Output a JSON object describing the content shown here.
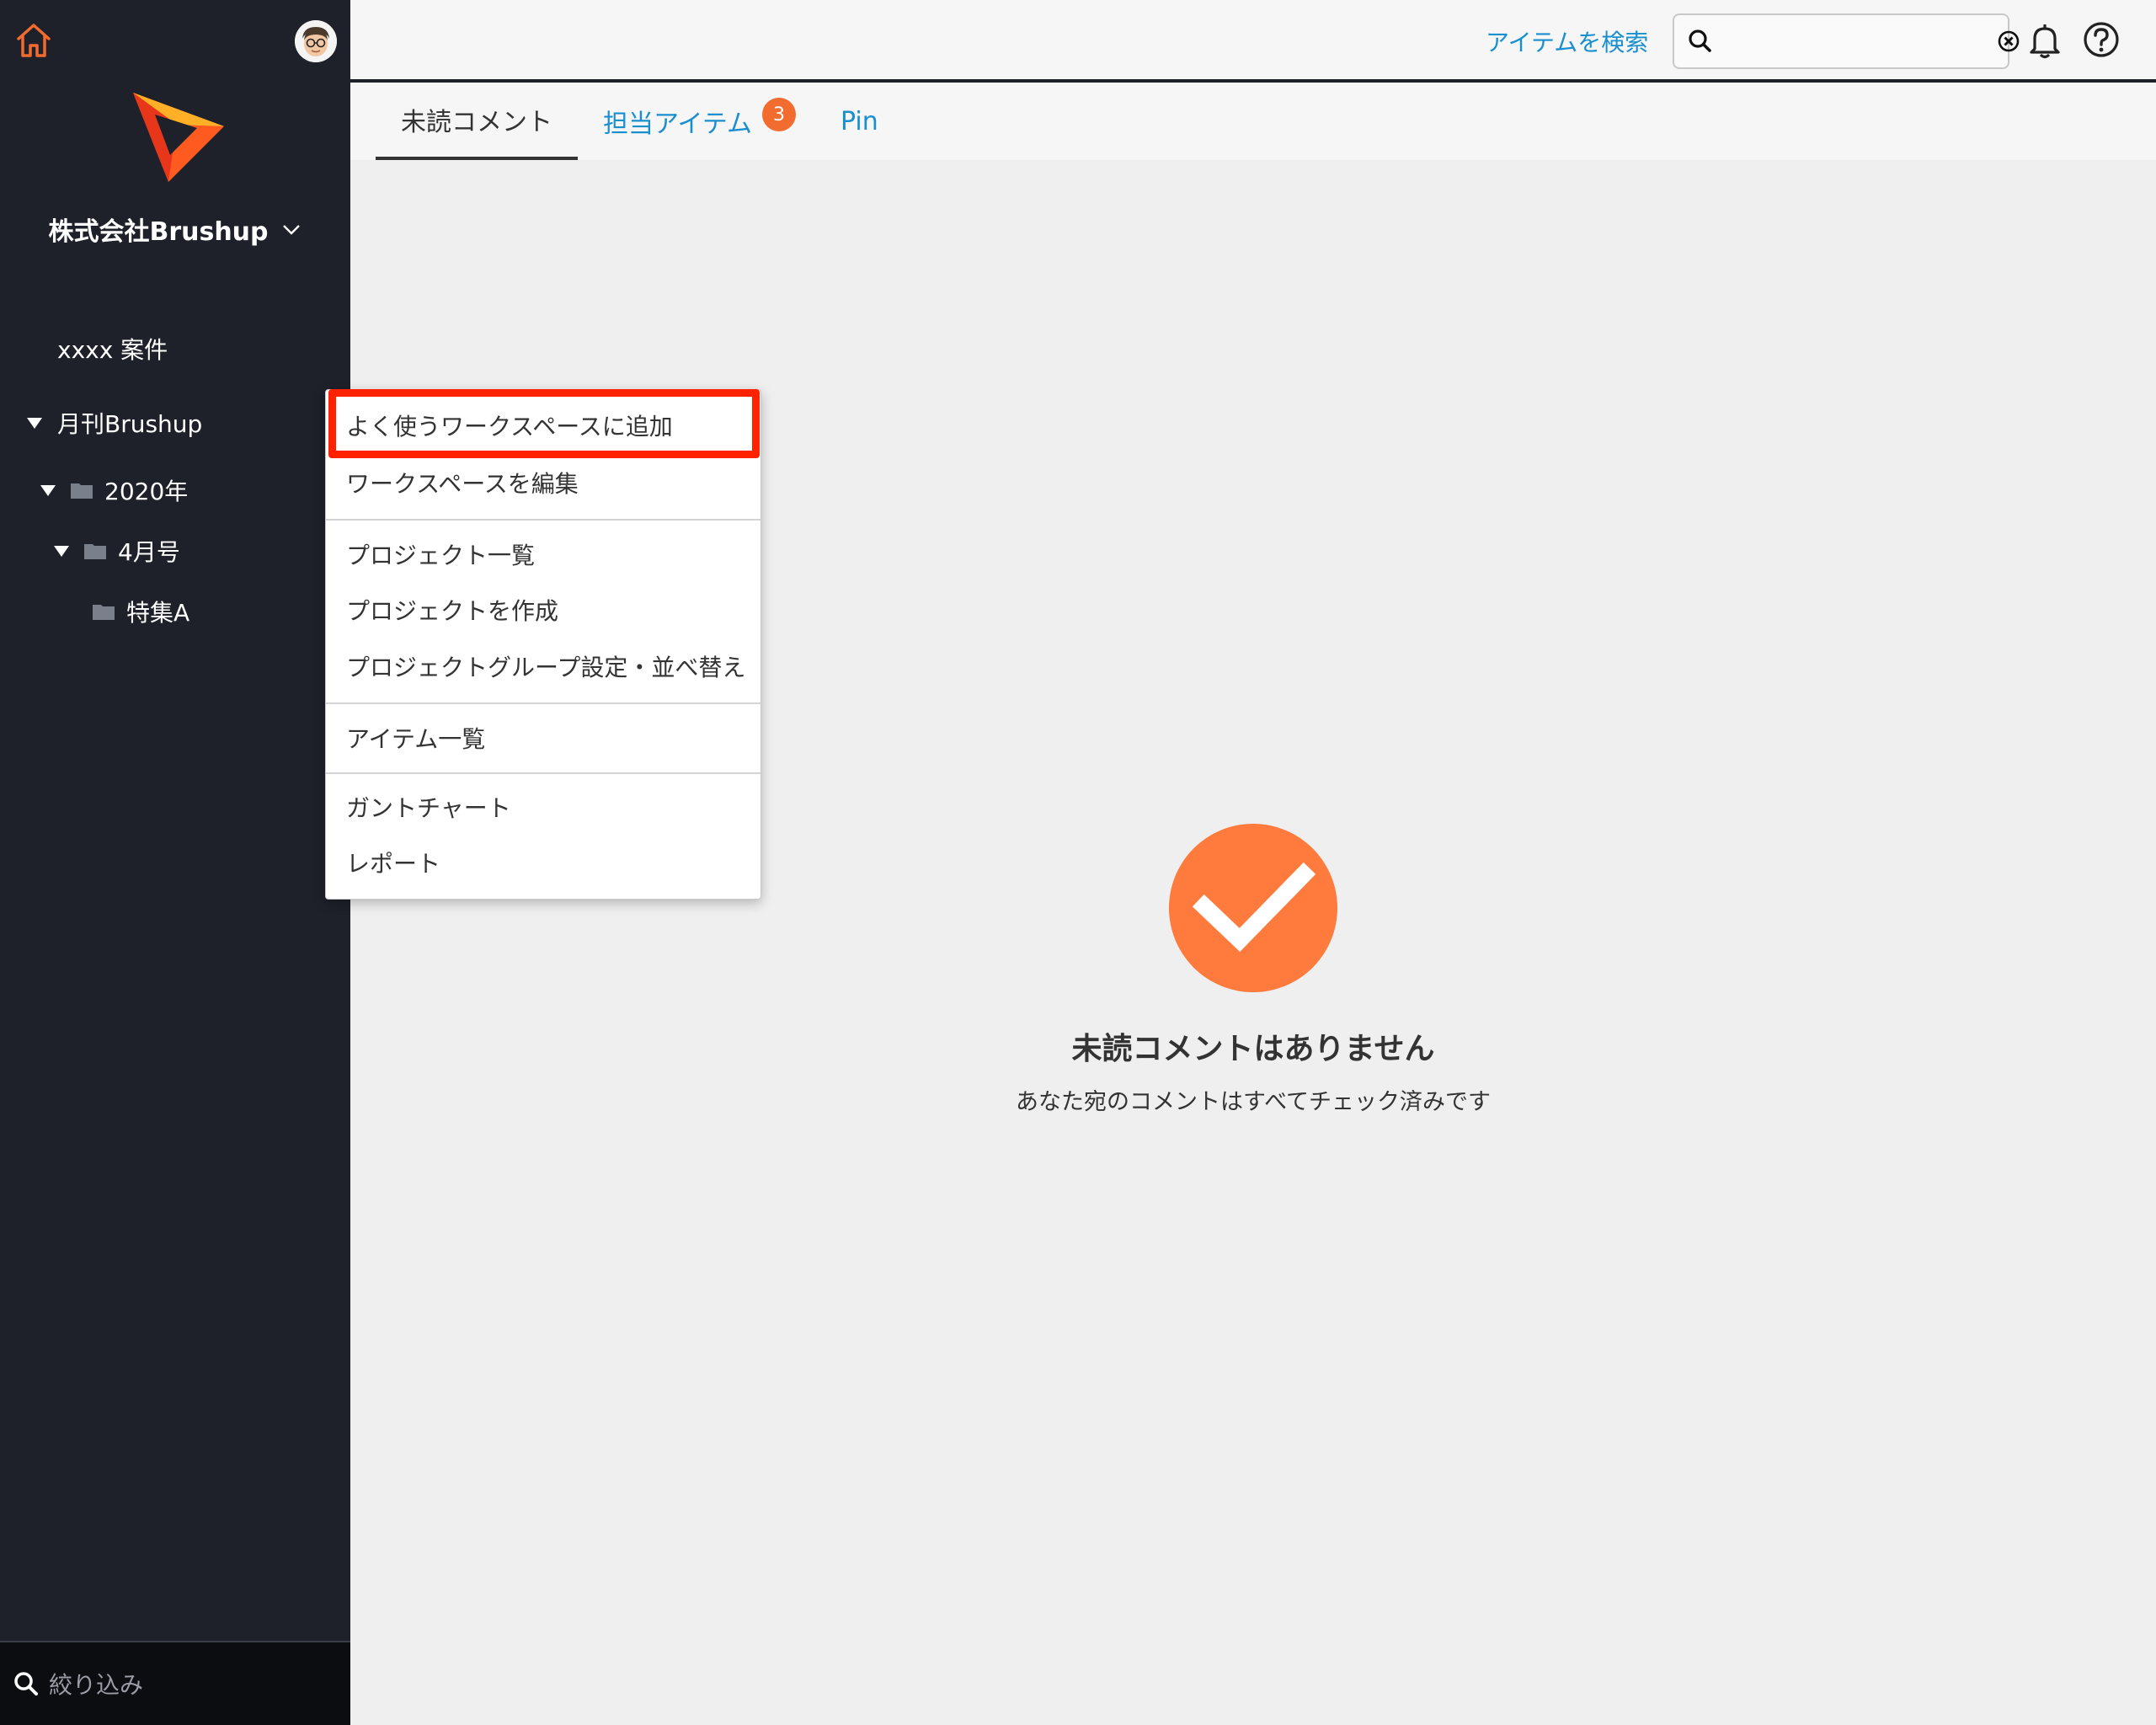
{
  "sidebar": {
    "company_name": "株式会社Brushup",
    "items": [
      {
        "label": "xxxx 案件"
      },
      {
        "label": "月刊Brushup"
      },
      {
        "label": "2020年"
      },
      {
        "label": "4月号"
      },
      {
        "label": "特集A"
      }
    ],
    "filter_placeholder": "絞り込み"
  },
  "topbar": {
    "search_label": "アイテムを検索",
    "search_value": ""
  },
  "tabs": [
    {
      "label": "未読コメント"
    },
    {
      "label": "担当アイテム",
      "badge": "3"
    },
    {
      "label": "Pin"
    }
  ],
  "empty_state": {
    "title": "未読コメントはありません",
    "subtitle": "あなた宛のコメントはすべてチェック済みです"
  },
  "context_menu": {
    "items": [
      "よく使うワークスペースに追加",
      "ワークスペースを編集",
      "プロジェクト一覧",
      "プロジェクトを作成",
      "プロジェクトグループ設定・並べ替え",
      "アイテム一覧",
      "ガントチャート",
      "レポート"
    ]
  },
  "colors": {
    "sidebar_bg": "#1e202a",
    "accent_orange": "#ff7a3d",
    "link_blue": "#1a8fd0",
    "highlight_red": "#ff2200",
    "badge_orange": "#f26b2f"
  },
  "icons": [
    "home-icon",
    "avatar",
    "brushup-logo-icon",
    "chevron-down-icon",
    "caret-down-icon",
    "folder-icon",
    "search-icon",
    "clear-icon",
    "bell-icon",
    "help-icon",
    "check-icon"
  ]
}
